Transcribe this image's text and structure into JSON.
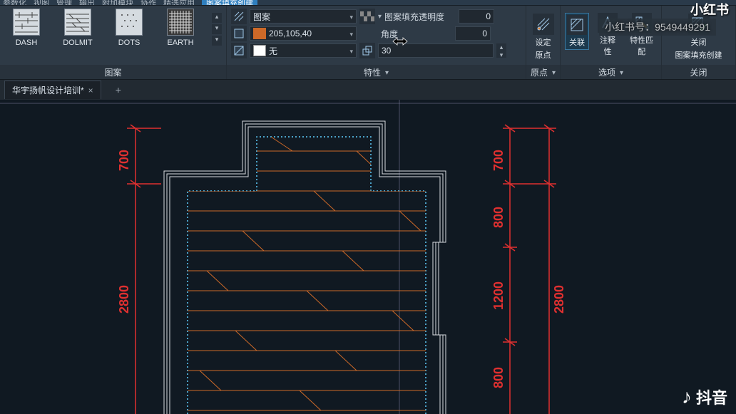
{
  "menus": [
    "参数化",
    "视图",
    "管理",
    "输出",
    "附加模块",
    "协作",
    "精选应用",
    "图案填充创建"
  ],
  "patterns": [
    {
      "name": "DASH"
    },
    {
      "name": "DOLMIT"
    },
    {
      "name": "DOTS"
    },
    {
      "name": "EARTH"
    }
  ],
  "panel_titles": {
    "pattern": "图案",
    "properties": "特性",
    "origin": "原点",
    "options": "选项",
    "close": "关闭"
  },
  "properties": {
    "pattern_type_label": "图案",
    "color_value": "205,105,40",
    "bg_label": "无",
    "transparency_label": "图案填充透明度",
    "transparency_value": "0",
    "angle_label": "角度",
    "angle_value": "0",
    "scale_value": "30"
  },
  "origin_btn": {
    "label1": "设定",
    "label2": "原点"
  },
  "options": {
    "assoc": "关联",
    "anno": "注释性",
    "match": "特性匹配"
  },
  "close_btn": {
    "label1": "关闭",
    "label2": "图案填充创建"
  },
  "file_tab": "华宇扬帆设计培训*",
  "dimensions": {
    "left_top_small": "700",
    "left_main": "2800",
    "right_top_small": "700",
    "right_seg1": "800",
    "right_seg2": "1200",
    "right_seg3": "800",
    "right_main": "2800"
  },
  "watermarks": {
    "xhs": "小红书",
    "xhs_id_label": "小红书号：",
    "xhs_id": "9549449291",
    "douyin": "抖音"
  }
}
